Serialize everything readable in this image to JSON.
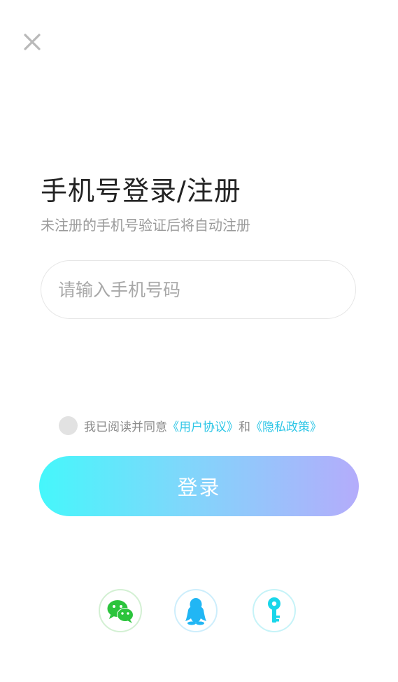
{
  "header": {
    "close_icon": "close-icon"
  },
  "login": {
    "title": "手机号登录/注册",
    "subtitle": "未注册的手机号验证后将自动注册",
    "phone_placeholder": "请输入手机号码",
    "phone_value": "",
    "agreement": {
      "prefix": "我已阅读并同意",
      "user_agreement": "《用户协议》",
      "conjunction": "和",
      "privacy_policy": "《隐私政策》",
      "checked": false
    },
    "submit_label": "登录"
  },
  "social_login": [
    {
      "name": "wechat",
      "icon": "wechat-icon",
      "color": "#2bc43c"
    },
    {
      "name": "qq",
      "icon": "qq-penguin-icon",
      "color": "#21b6f4"
    },
    {
      "name": "key",
      "icon": "key-icon",
      "color": "#19d6ea"
    }
  ],
  "colors": {
    "accent_link": "#2ec6e6",
    "button_gradient_start": "#45f7fb",
    "button_gradient_end": "#b4acfb",
    "title": "#222222",
    "subtitle": "#9a9a9a"
  }
}
